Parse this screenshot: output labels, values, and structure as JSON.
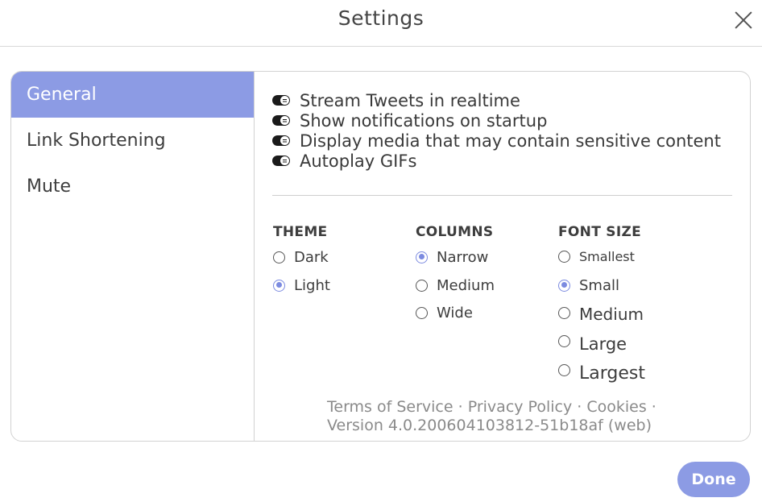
{
  "dialog": {
    "title": "Settings",
    "done_label": "Done"
  },
  "sidebar": {
    "items": [
      {
        "label": "General"
      },
      {
        "label": "Link Shortening"
      },
      {
        "label": "Mute"
      }
    ]
  },
  "toggles": [
    {
      "label": "Stream Tweets in realtime",
      "on": true
    },
    {
      "label": "Show notifications on startup",
      "on": true
    },
    {
      "label": "Display media that may contain sensitive content",
      "on": true
    },
    {
      "label": "Autoplay GIFs",
      "on": true
    }
  ],
  "theme": {
    "heading": "THEME",
    "options": [
      {
        "label": "Dark",
        "selected": false
      },
      {
        "label": "Light",
        "selected": true
      }
    ]
  },
  "columns": {
    "heading": "COLUMNS",
    "options": [
      {
        "label": "Narrow",
        "selected": true
      },
      {
        "label": "Medium",
        "selected": false
      },
      {
        "label": "Wide",
        "selected": false
      }
    ]
  },
  "font_size": {
    "heading": "FONT SIZE",
    "options": [
      {
        "label": "Smallest",
        "selected": false
      },
      {
        "label": "Small",
        "selected": true
      },
      {
        "label": "Medium",
        "selected": false
      },
      {
        "label": "Large",
        "selected": false
      },
      {
        "label": "Largest",
        "selected": false
      }
    ]
  },
  "footer": {
    "terms": "Terms of Service",
    "privacy": "Privacy Policy",
    "cookies": "Cookies",
    "separator": "·",
    "version": "Version 4.0.200604103812-51b18af (web)"
  },
  "colors": {
    "accent": "#8c9be4",
    "radio_selected": "#7c8be0"
  }
}
